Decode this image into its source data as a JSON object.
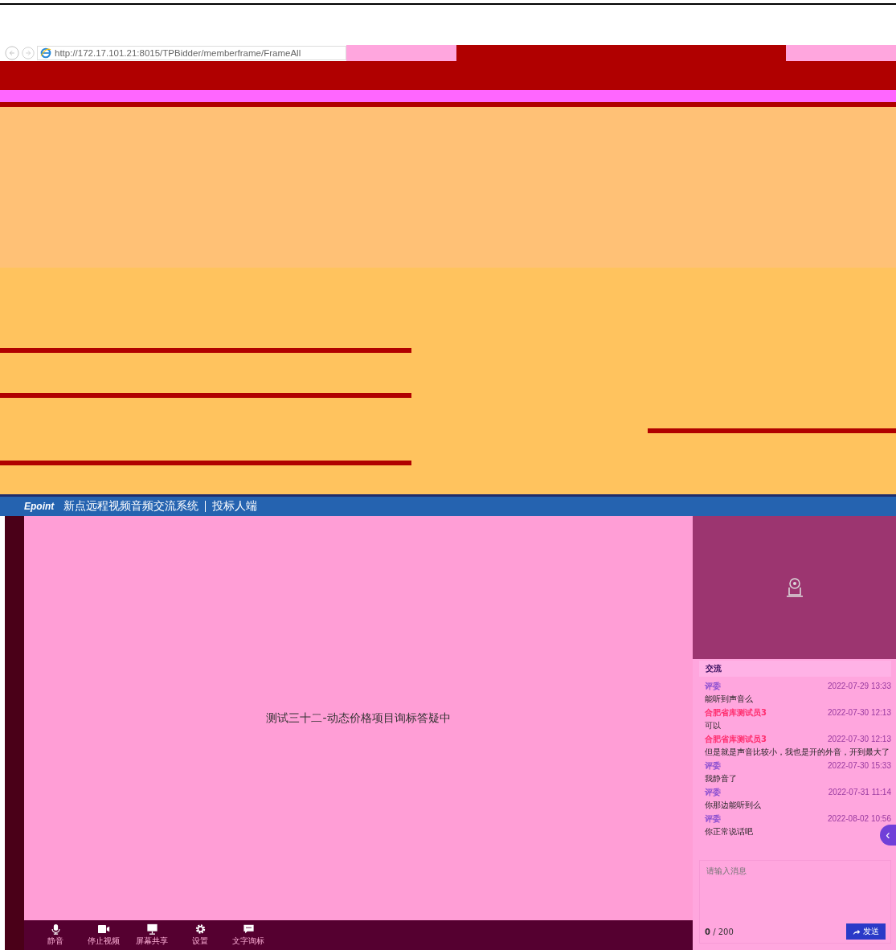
{
  "browser": {
    "url": "http://172.17.101.21:8015/TPBidder/memberframe/FrameAll"
  },
  "app": {
    "logo": "Epoint",
    "title": "新点远程视频音频交流系统",
    "role": "投标人端"
  },
  "video": {
    "caption": "测试三十二-动态价格项目询标答疑中"
  },
  "toolbar": [
    {
      "label": "静音",
      "kind": "mic"
    },
    {
      "label": "停止视频",
      "kind": "camera"
    },
    {
      "label": "屏幕共享",
      "kind": "screen"
    },
    {
      "label": "设置",
      "kind": "gear"
    },
    {
      "label": "文字询标",
      "kind": "chat"
    }
  ],
  "chat": {
    "title": "交流",
    "messages": [
      {
        "sender": "评委",
        "color": "#8a4fd0",
        "time": "2022-07-29 13:33",
        "text": "能听到声音么"
      },
      {
        "sender": "合肥省库测试员3",
        "color": "#ff2d6e",
        "time": "2022-07-30 12:13",
        "text": "可以"
      },
      {
        "sender": "合肥省库测试员3",
        "color": "#ff2d6e",
        "time": "2022-07-30 12:13",
        "text": "但是就是声音比较小，我也是开的外音，开到最大了"
      },
      {
        "sender": "评委",
        "color": "#8a4fd0",
        "time": "2022-07-30 15:33",
        "text": "我静音了"
      },
      {
        "sender": "评委",
        "color": "#8a4fd0",
        "time": "2022-07-31 11:14",
        "text": "你那边能听到么"
      },
      {
        "sender": "评委",
        "color": "#8a4fd0",
        "time": "2022-08-02 10:56",
        "text": "你正常说话吧"
      }
    ],
    "placeholder": "请输入消息",
    "counter": "**0** / 200",
    "send": "发送",
    "collapse": "‹"
  }
}
